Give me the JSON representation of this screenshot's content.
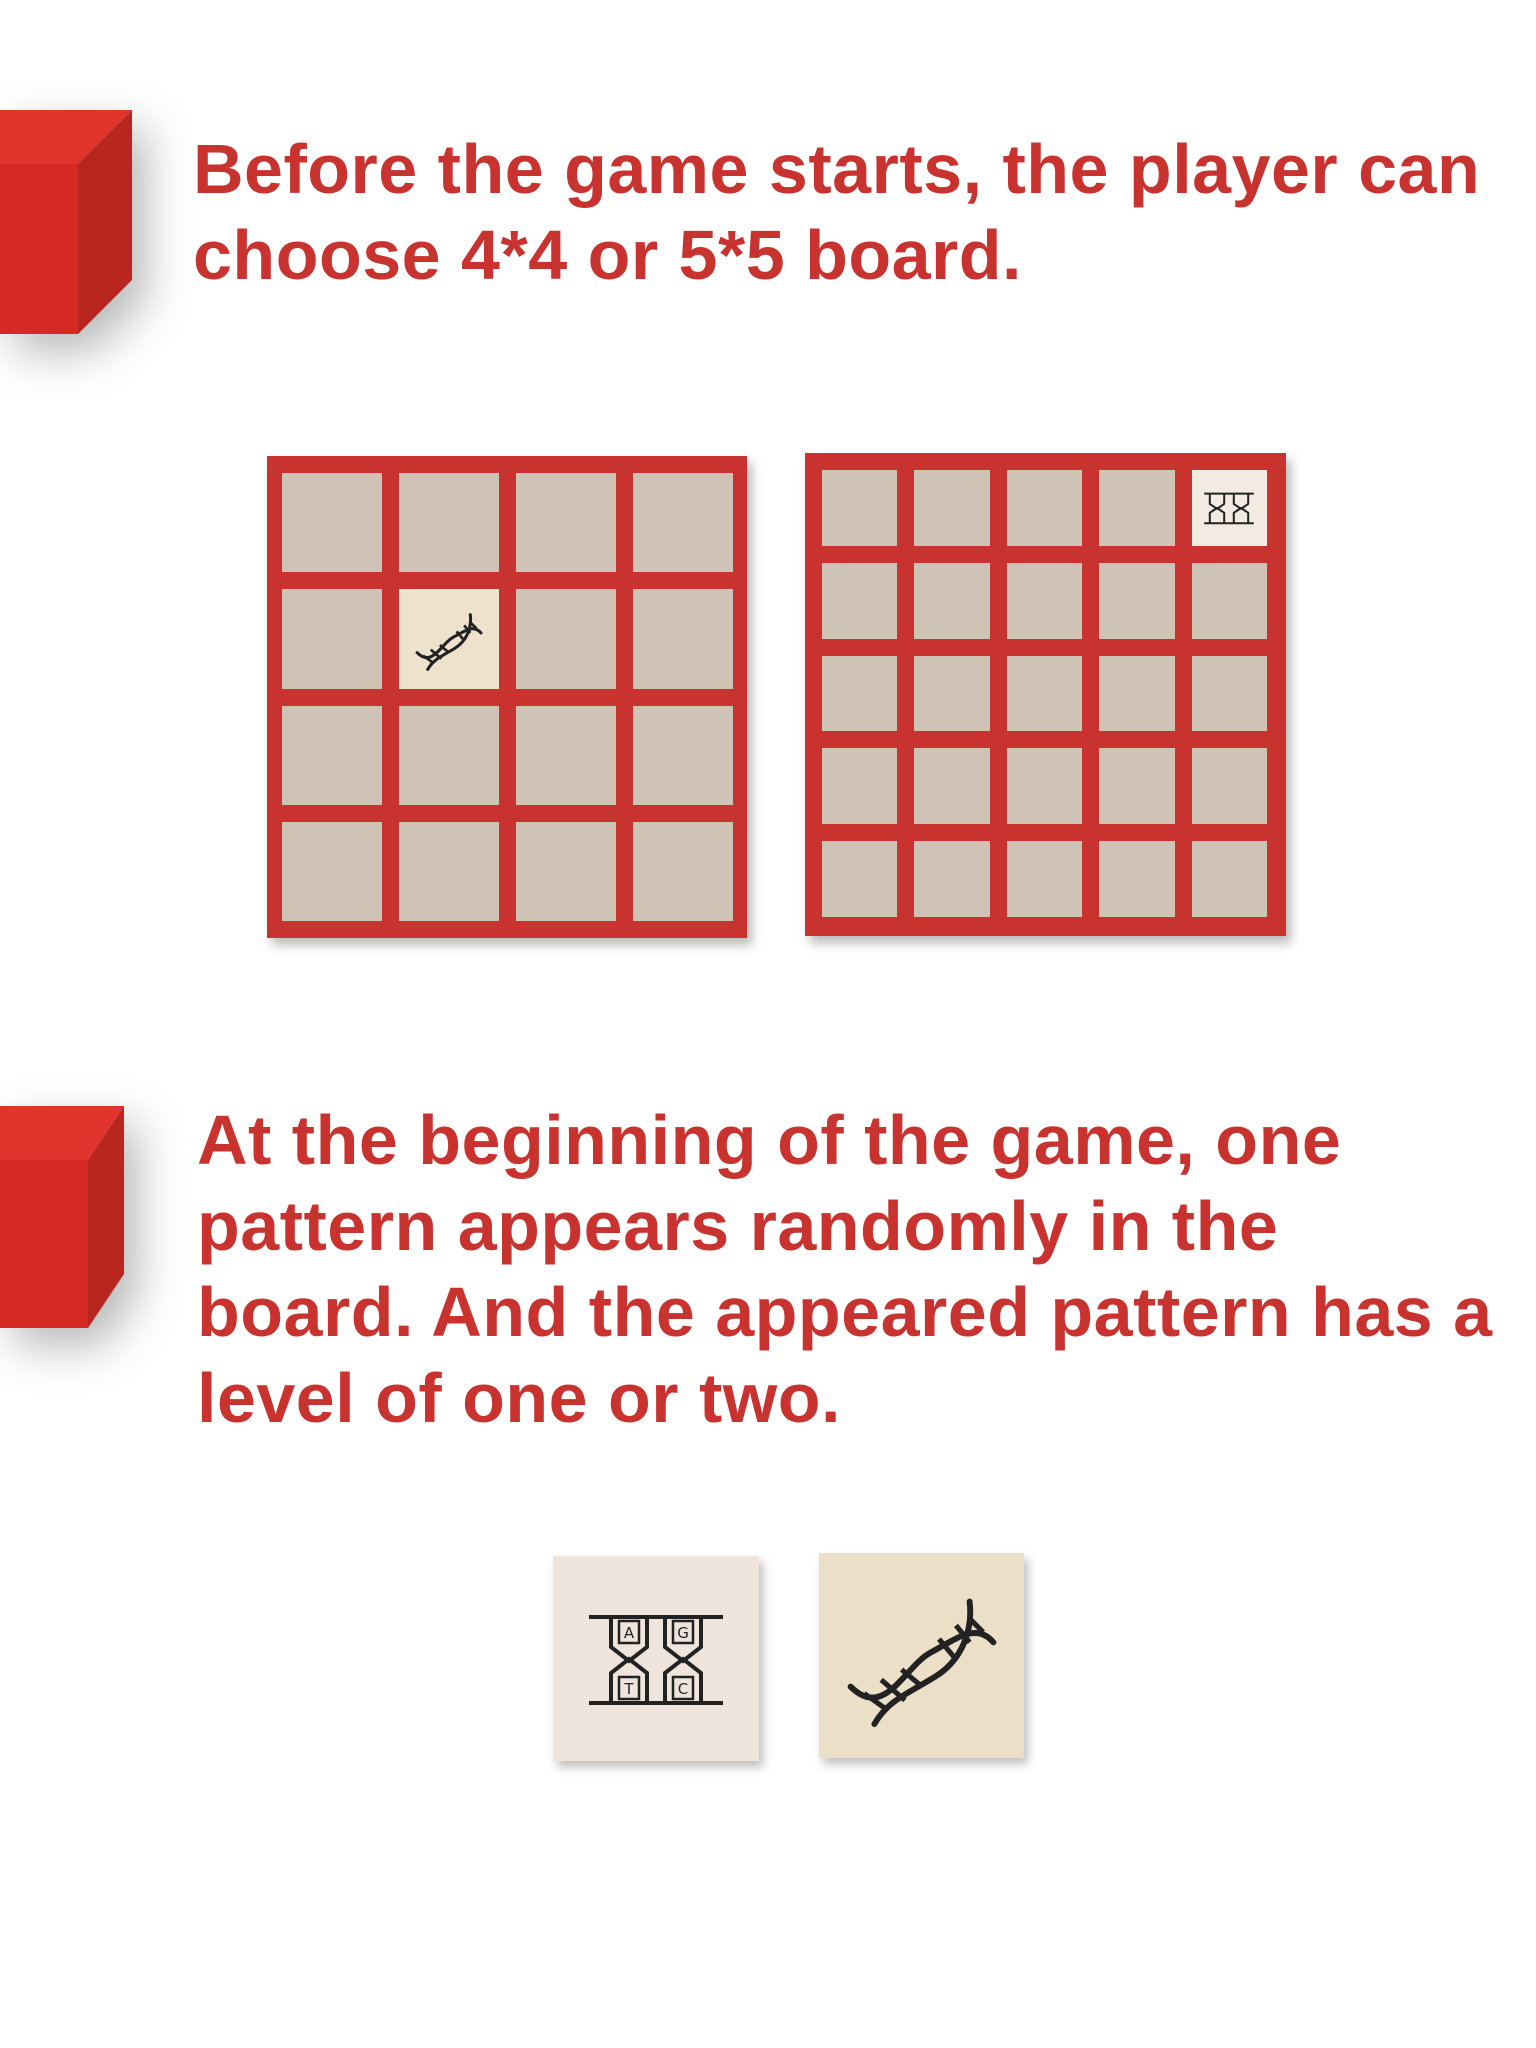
{
  "instructions": {
    "step1_text": "Before the game starts, the player can choose 4*4 or 5*5 board.",
    "step2_text": "At the beginning of the game, one pattern appears randomly in the board. And the appeared pattern has a level of one or two."
  },
  "colors": {
    "accent_red": "#c8322f",
    "board_red": "#c8322f",
    "cell_empty": "#cfc3b5",
    "cell_dna": "#efe2cc",
    "cell_gene": "#f3ebe2"
  },
  "boards": [
    {
      "size": "4*4",
      "pattern_cell": {
        "row": 2,
        "col": 2,
        "pattern": "dna-helix-icon"
      }
    },
    {
      "size": "5*5",
      "pattern_cell": {
        "row": 1,
        "col": 5,
        "pattern": "gene-agtc-icon"
      }
    }
  ],
  "patterns": [
    {
      "icon": "gene-agtc-icon",
      "letters": [
        "A",
        "G",
        "T",
        "C"
      ]
    },
    {
      "icon": "dna-helix-icon"
    }
  ]
}
